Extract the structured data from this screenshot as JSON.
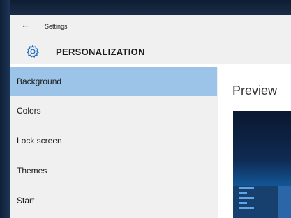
{
  "window": {
    "app_title": "Settings",
    "back_icon": "back-arrow-icon"
  },
  "header": {
    "icon": "gear-icon",
    "title": "PERSONALIZATION"
  },
  "sidebar": {
    "items": [
      {
        "label": "Background",
        "selected": true
      },
      {
        "label": "Colors",
        "selected": false
      },
      {
        "label": "Lock screen",
        "selected": false
      },
      {
        "label": "Themes",
        "selected": false
      },
      {
        "label": "Start",
        "selected": false
      }
    ]
  },
  "main": {
    "preview_label": "Preview"
  },
  "colors": {
    "accent_selected": "#9cc4e8",
    "panel_bg": "#f0f0f0",
    "desktop_blue": "#145fa4"
  }
}
